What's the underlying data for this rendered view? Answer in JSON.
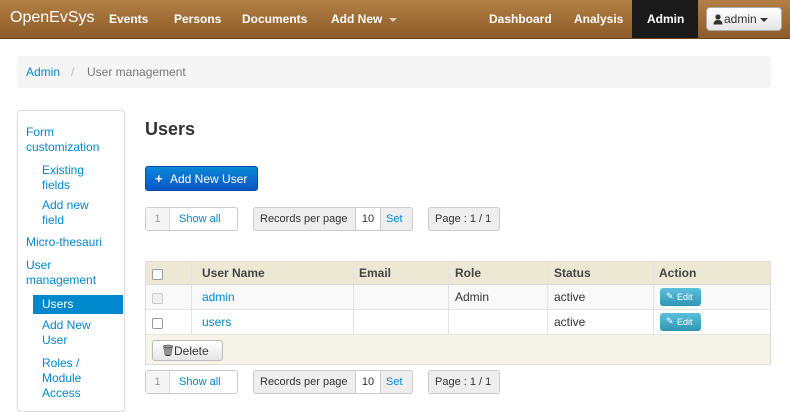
{
  "navbar": {
    "brand": "OpenEvSys",
    "items": [
      "Events",
      "Persons",
      "Documents",
      "Add New"
    ],
    "right_items": [
      "Dashboard",
      "Analysis",
      "Admin"
    ],
    "user_label": "admin",
    "colors": {
      "bar": "#9c6a36",
      "active": "#1a1a1a"
    }
  },
  "breadcrumb": {
    "root": "Admin",
    "separator": "/",
    "current": "User management"
  },
  "sidebar": {
    "items": [
      "Form customization",
      "Existing fields",
      "Add new field",
      "Micro-thesauri",
      "User management",
      "Users",
      "Add New User",
      "Roles / Module Access"
    ],
    "active": "Users",
    "accent": "#0088cc"
  },
  "main": {
    "title": "Users",
    "add_button": "Add New User",
    "pager": {
      "page_number": "1",
      "show_all": "Show all",
      "records_label": "Records per page",
      "records_value": "10",
      "set_label": "Set",
      "page_info": "Page : 1 / 1"
    }
  },
  "table": {
    "columns": [
      "User Name",
      "Email",
      "Role",
      "Status",
      "Action"
    ],
    "rows": [
      {
        "username": "admin",
        "email": "",
        "role": "Admin",
        "status": "active",
        "action": "Edit"
      },
      {
        "username": "users",
        "email": "",
        "role": "",
        "status": "active",
        "action": "Edit"
      }
    ],
    "delete_label": "Delete"
  },
  "icons": [
    "caret-down-icon",
    "user-icon",
    "plus-icon",
    "edit-icon",
    "trash-icon",
    "checkbox-icon"
  ]
}
